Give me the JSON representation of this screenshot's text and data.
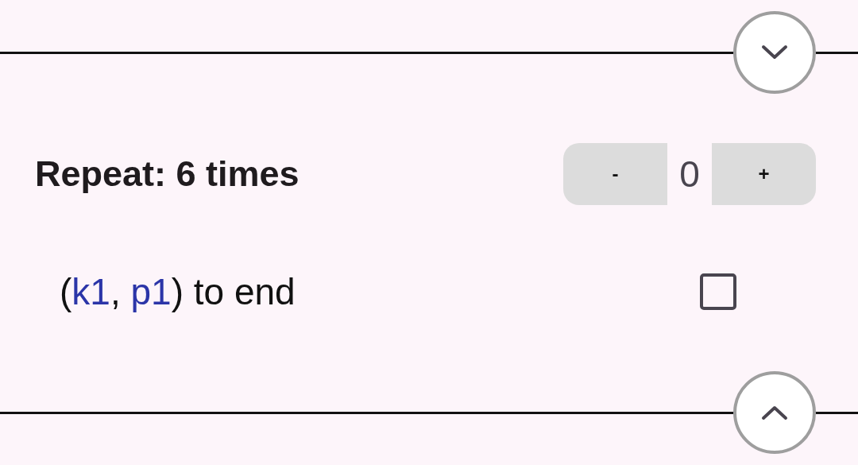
{
  "repeat": {
    "label": "Repeat: 6 times",
    "counter": {
      "decrement": "-",
      "value": "0",
      "increment": "+"
    }
  },
  "instructions": [
    {
      "parts": [
        {
          "kind": "plain",
          "text": "("
        },
        {
          "kind": "stitch",
          "text": "k1"
        },
        {
          "kind": "plain",
          "text": ", "
        },
        {
          "kind": "stitch",
          "text": "p1"
        },
        {
          "kind": "plain",
          "text": ") to end"
        }
      ],
      "checked": false
    }
  ]
}
